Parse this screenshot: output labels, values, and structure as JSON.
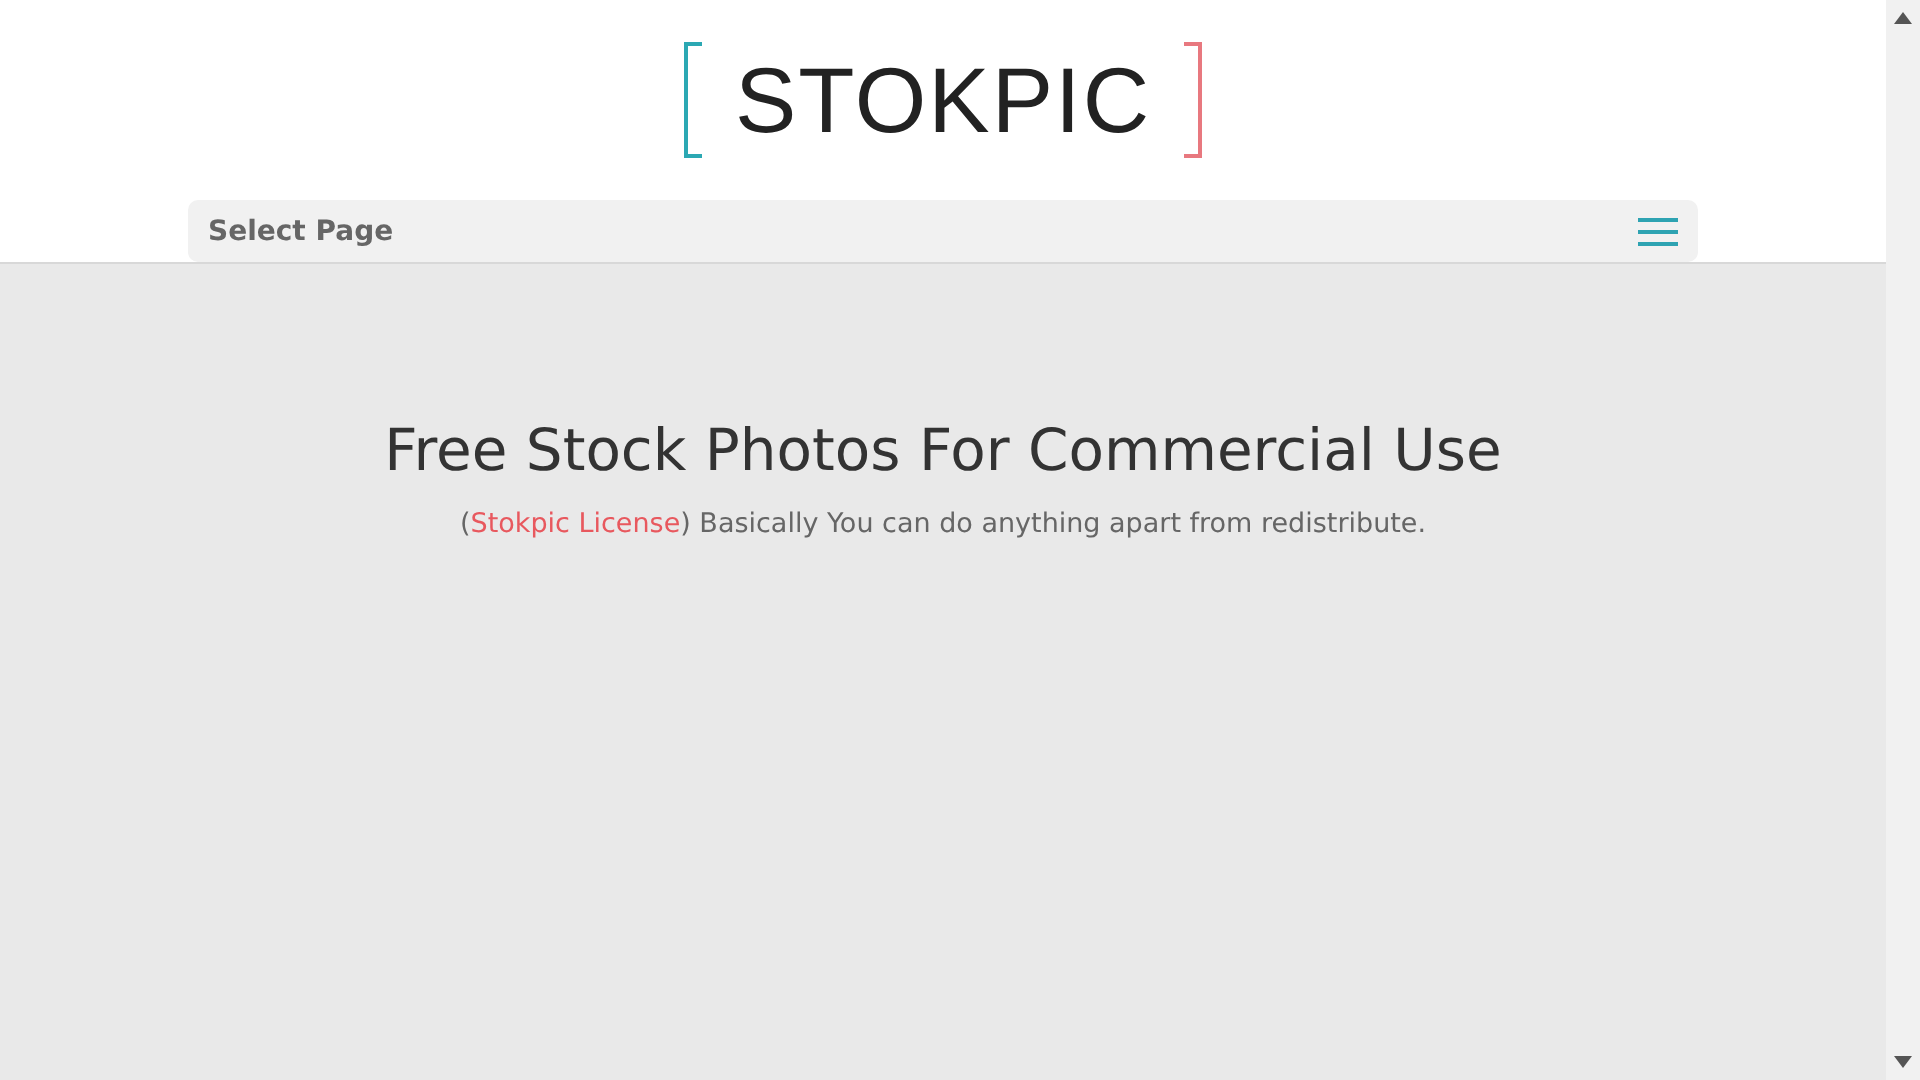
{
  "header": {
    "logo": "STOKPIC",
    "menu": {
      "label": "Select Page"
    }
  },
  "hero": {
    "title": "Free Stock Photos For Commercial Use",
    "subtitle": {
      "before": "(",
      "link": "Stokpic License",
      "after": ") Basically You can do anything apart from redistribute."
    }
  }
}
